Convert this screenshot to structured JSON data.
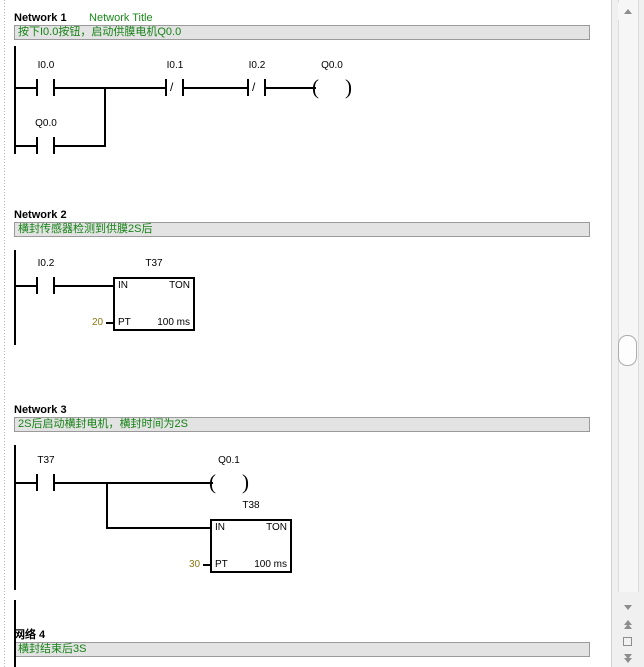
{
  "editor": {
    "kind": "ladder-logic-editor",
    "networks": [
      {
        "name": "Network 1",
        "title": "Network Title",
        "comment": "按下I0.0按钮，启动供膜电机Q0.0",
        "elements": {
          "contact1": "I0.0",
          "contact2": "I0.1",
          "contact3": "I0.2",
          "coil": "Q0.0",
          "branch_contact": "Q0.0"
        }
      },
      {
        "name": "Network 2",
        "title": "",
        "comment": "横封传感器检测到供膜2S后",
        "elements": {
          "contact1": "I0.2",
          "timer_name": "T37",
          "timer_in": "IN",
          "timer_fn": "TON",
          "timer_pt_label": "PT",
          "timer_pt_value": "20",
          "timer_base": "100 ms"
        }
      },
      {
        "name": "Network 3",
        "title": "",
        "comment": "2S后启动横封电机，横封时间为2S",
        "elements": {
          "contact1": "T37",
          "coil": "Q0.1",
          "timer_name": "T38",
          "timer_in": "IN",
          "timer_fn": "TON",
          "timer_pt_label": "PT",
          "timer_pt_value": "30",
          "timer_base": "100 ms"
        }
      },
      {
        "name": "网络 4",
        "title": "",
        "comment": "横封结束后3S",
        "elements": {}
      }
    ]
  },
  "scrollbar": {
    "up_arrow": "scroll-up-arrow",
    "nav_down": "nav-down-arrow",
    "nav_up_double": "nav-up-double-arrow",
    "nav_stop": "nav-stop-square",
    "nav_down_double": "nav-down-double-arrow"
  },
  "colors": {
    "comment_text": "#168316",
    "comment_bg": "#e3e3e3",
    "title_text": "#1a8a1a",
    "pt_value": "#8a7a12",
    "wire": "#000000"
  }
}
